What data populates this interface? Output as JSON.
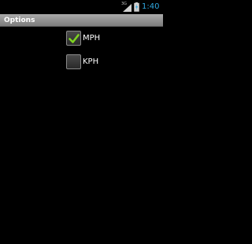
{
  "status_bar": {
    "network": "3G",
    "time": "1:40",
    "signal_icon": "signal-strength-icon",
    "battery_icon": "battery-charging-icon",
    "clock_color": "#2fa8e0"
  },
  "title_bar": {
    "title": "Options"
  },
  "options": [
    {
      "label": "MPH",
      "checked": true
    },
    {
      "label": "KPH",
      "checked": false
    }
  ],
  "colors": {
    "background": "#000000",
    "check_green": "#7ed321",
    "title_bar": "#8c8c8c"
  }
}
